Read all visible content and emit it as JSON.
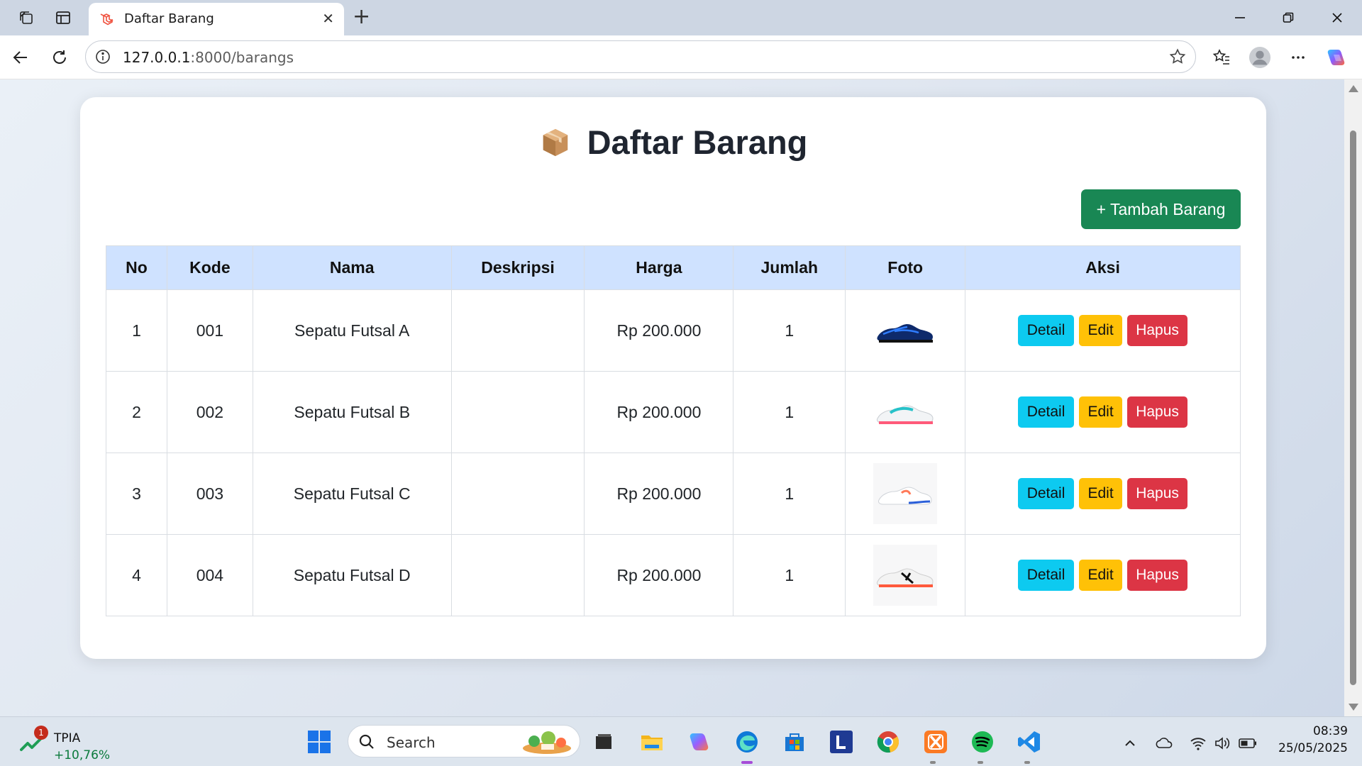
{
  "browser": {
    "tab_title": "Daftar Barang",
    "new_tab_label": "+",
    "url_host": "127.0.0.1",
    "url_rest": ":8000/barangs"
  },
  "page": {
    "title": "Daftar Barang",
    "add_button": "+ Tambah Barang"
  },
  "table": {
    "headers": [
      "No",
      "Kode",
      "Nama",
      "Deskripsi",
      "Harga",
      "Jumlah",
      "Foto",
      "Aksi"
    ],
    "rows": [
      {
        "no": "1",
        "kode": "001",
        "nama": "Sepatu Futsal A",
        "deskripsi": "",
        "harga": "Rp 200.000",
        "jumlah": "1"
      },
      {
        "no": "2",
        "kode": "002",
        "nama": "Sepatu Futsal B",
        "deskripsi": "",
        "harga": "Rp 200.000",
        "jumlah": "1"
      },
      {
        "no": "3",
        "kode": "003",
        "nama": "Sepatu Futsal C",
        "deskripsi": "",
        "harga": "Rp 200.000",
        "jumlah": "1"
      },
      {
        "no": "4",
        "kode": "004",
        "nama": "Sepatu Futsal D",
        "deskripsi": "",
        "harga": "Rp 200.000",
        "jumlah": "1"
      }
    ],
    "actions": {
      "detail": "Detail",
      "edit": "Edit",
      "hapus": "Hapus"
    }
  },
  "taskbar": {
    "stock_badge": "1",
    "stock_ticker": "TPIA",
    "stock_change": "+10,76%",
    "search_placeholder": "Search",
    "time": "08:39",
    "date": "25/05/2025"
  },
  "colors": {
    "add_button": "#198754",
    "table_header": "#cfe2ff",
    "detail_button": "#0dcaf0",
    "edit_button": "#ffc107",
    "hapus_button": "#dc3545",
    "stock_change": "#0b7a3c"
  },
  "icons": {
    "tab_favicon": "laravel-icon",
    "page_title": "package-box-icon",
    "taskbar_apps": [
      "windows-start-icon",
      "file-explorer-icon",
      "folder-icon",
      "copilot-icon",
      "edge-icon",
      "microsoft-store-icon",
      "l-app-icon",
      "chrome-icon",
      "xampp-icon",
      "spotify-icon",
      "vscode-icon"
    ]
  }
}
